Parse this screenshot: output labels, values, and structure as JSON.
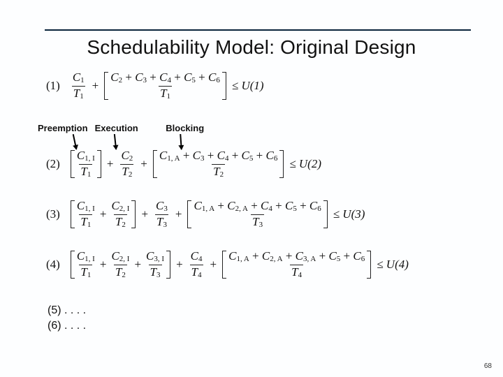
{
  "title": "Schedulability Model: Original Design",
  "labels": {
    "preemption": "Preemption",
    "execution": "Execution",
    "blocking": "Blocking"
  },
  "eq1": {
    "n": "(1)",
    "f1n": "C",
    "f1ns": "1",
    "f1d": "T",
    "f1ds": "1",
    "big_num": [
      "C",
      "2",
      " + ",
      "C",
      "3",
      " + ",
      "C",
      "4",
      " + ",
      "C",
      "5",
      " + ",
      "C",
      "6"
    ],
    "big_d": "T",
    "big_ds": "1",
    "rhs": "≤ U(1)"
  },
  "eq2": {
    "n": "(2)",
    "b1n": "C",
    "b1ns": "1, I",
    "b1d": "T",
    "b1ds": "1",
    "f2n": "C",
    "f2ns": "2",
    "f2d": "T",
    "f2ds": "2",
    "big_num": [
      "C",
      "1, A",
      " + ",
      "C",
      "3",
      " + ",
      "C",
      "4",
      " + ",
      "C",
      "5",
      " + ",
      "C",
      "6"
    ],
    "big_d": "T",
    "big_ds": "2",
    "rhs": "≤ U(2)"
  },
  "eq3": {
    "n": "(3)",
    "p": [
      {
        "n": "C",
        "ns": "1, I",
        "d": "T",
        "ds": "1"
      },
      {
        "n": "C",
        "ns": "2, I",
        "d": "T",
        "ds": "2"
      }
    ],
    "ex": {
      "n": "C",
      "ns": "3",
      "d": "T",
      "ds": "3"
    },
    "big_num": [
      "C",
      "1, A",
      " + ",
      "C",
      "2, A",
      " + ",
      "C",
      "4",
      " + ",
      "C",
      "5",
      " + ",
      "C",
      "6"
    ],
    "big_d": "T",
    "big_ds": "3",
    "rhs": "≤ U(3)"
  },
  "eq4": {
    "n": "(4)",
    "p": [
      {
        "n": "C",
        "ns": "1, I",
        "d": "T",
        "ds": "1"
      },
      {
        "n": "C",
        "ns": "2, I",
        "d": "T",
        "ds": "2"
      },
      {
        "n": "C",
        "ns": "3, I",
        "d": "T",
        "ds": "3"
      }
    ],
    "ex": {
      "n": "C",
      "ns": "4",
      "d": "T",
      "ds": "4"
    },
    "big_num": [
      "C",
      "1, A",
      " + ",
      "C",
      "2, A",
      " + ",
      "C",
      "3, A",
      " + ",
      "C",
      "5",
      " + ",
      "C",
      "6"
    ],
    "big_d": "T",
    "big_ds": "4",
    "rhs": "≤ U(4)"
  },
  "tail": {
    "l5": "(5) . . . .",
    "l6": "(6) . . . ."
  },
  "page": "68"
}
